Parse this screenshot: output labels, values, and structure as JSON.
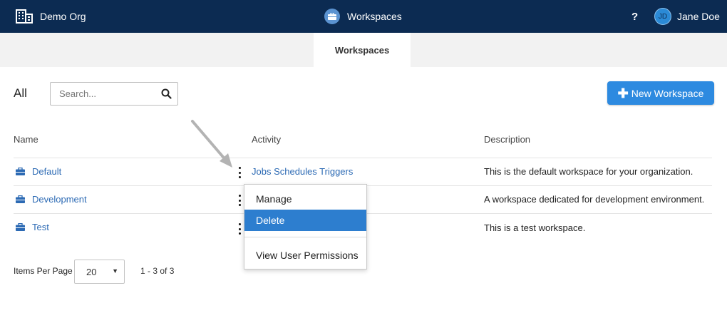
{
  "topbar": {
    "org_name": "Demo Org",
    "center_title": "Workspaces",
    "help_label": "?",
    "user_initials": "JD",
    "user_name": "Jane Doe"
  },
  "tabs": [
    {
      "label": "Workspaces",
      "active": true
    }
  ],
  "toolbar": {
    "filter_label": "All",
    "search_placeholder": "Search...",
    "new_button_label": "New Workspace"
  },
  "table": {
    "columns": [
      "Name",
      "Activity",
      "Description"
    ],
    "rows": [
      {
        "name": "Default",
        "activity": "Jobs Schedules Triggers",
        "description": "This is the default workspace for your organization."
      },
      {
        "name": "Development",
        "activity": "",
        "description": "A workspace dedicated for development environment."
      },
      {
        "name": "Test",
        "activity": "",
        "description": "This is a test workspace."
      }
    ]
  },
  "context_menu": {
    "items": [
      "Manage",
      "Delete",
      "View User Permissions"
    ],
    "highlighted": "Delete"
  },
  "pagination": {
    "items_per_page_label": "Items Per Page",
    "items_per_page_value": "20",
    "range_text": "1 - 3 of 3"
  },
  "colors": {
    "topbar": "#0c2b52",
    "accent": "#2d8ae0",
    "link": "#2c6ab4",
    "menu_highlight": "#2d7ecf"
  }
}
